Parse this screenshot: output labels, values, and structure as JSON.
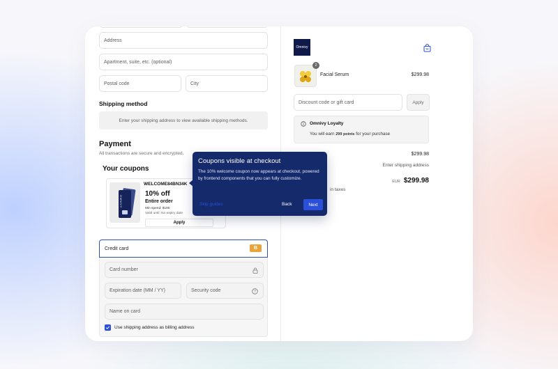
{
  "form": {
    "address_placeholder": "Address",
    "apartment_placeholder": "Apartment, suite, etc. (optional)",
    "postal_placeholder": "Postal code",
    "city_placeholder": "City"
  },
  "shipping": {
    "title": "Shipping method",
    "message": "Enter your shipping address to view available shipping methods."
  },
  "payment": {
    "title": "Payment",
    "subtitle": "All transactions are secure and encrypted.",
    "coupons_title": "Your coupons",
    "coupon": {
      "code": "WELCOME84BN34K",
      "discount": "10% off",
      "scope": "Entire order",
      "min_spend": "Min spend: $100",
      "valid": "Valid until: No expiry date",
      "apply": "Apply",
      "card_text": "OMNIVY"
    },
    "credit_card_label": "Credit card",
    "credit_card_badge": "B",
    "card_number_placeholder": "Card number",
    "expiration_placeholder": "Expiration date (MM / YY)",
    "security_placeholder": "Security code",
    "name_placeholder": "Name on card",
    "billing_checkbox_label": "Use shipping address as billing address",
    "billing_checked": true
  },
  "tooltip": {
    "title": "Coupons visible at checkout",
    "body": "The 10% welcome coupon now appears at checkout, powered by frontend components that you can fully customize.",
    "skip": "Skip guides",
    "back": "Back",
    "next": "Next"
  },
  "summary": {
    "logo_text": "Omnivy",
    "product_name": "Facial Serum",
    "product_qty": "2",
    "product_price": "$299.98",
    "discount_placeholder": "Discount code or gift card",
    "apply": "Apply",
    "loyalty_title": "Omnivy Loyalty",
    "loyalty_prefix": "You will earn",
    "loyalty_points": "299 points",
    "loyalty_suffix": "for your purchase",
    "subtotal_value": "$299.98",
    "shipping_value": "Enter shipping address",
    "total_currency": "EUR",
    "total_value": "$299.98",
    "taxes_text": "in taxes"
  }
}
